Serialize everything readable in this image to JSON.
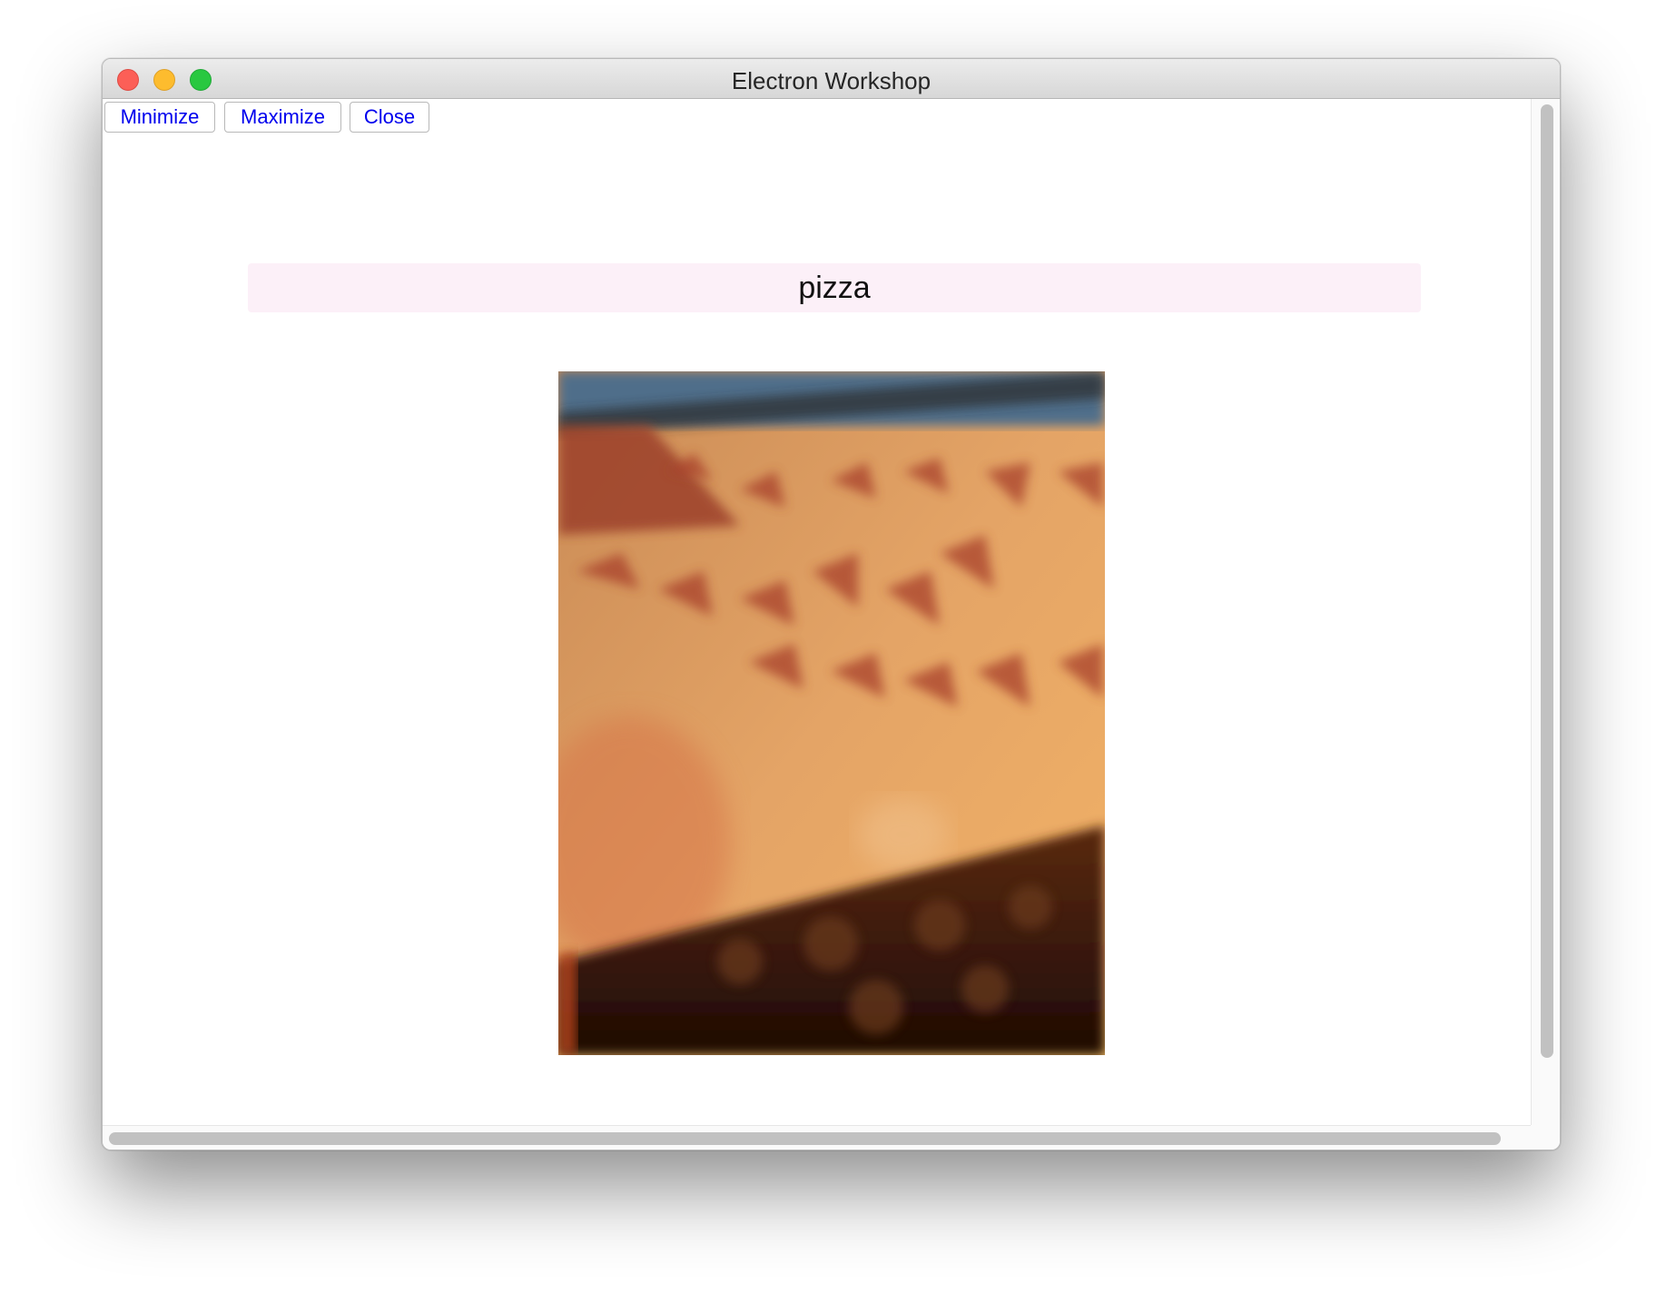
{
  "window": {
    "title": "Electron Workshop"
  },
  "controls": {
    "minimize_label": "Minimize",
    "maximize_label": "Maximize",
    "close_label": "Close"
  },
  "main": {
    "heading": "pizza"
  },
  "colors": {
    "link_blue": "#0000ee",
    "heading_bg": "#fcf0f8",
    "traffic_close": "#fc5f57",
    "traffic_minimize": "#fdbc2e",
    "traffic_maximize": "#28c840"
  },
  "icons": {
    "image": "pizza-box-photo"
  }
}
